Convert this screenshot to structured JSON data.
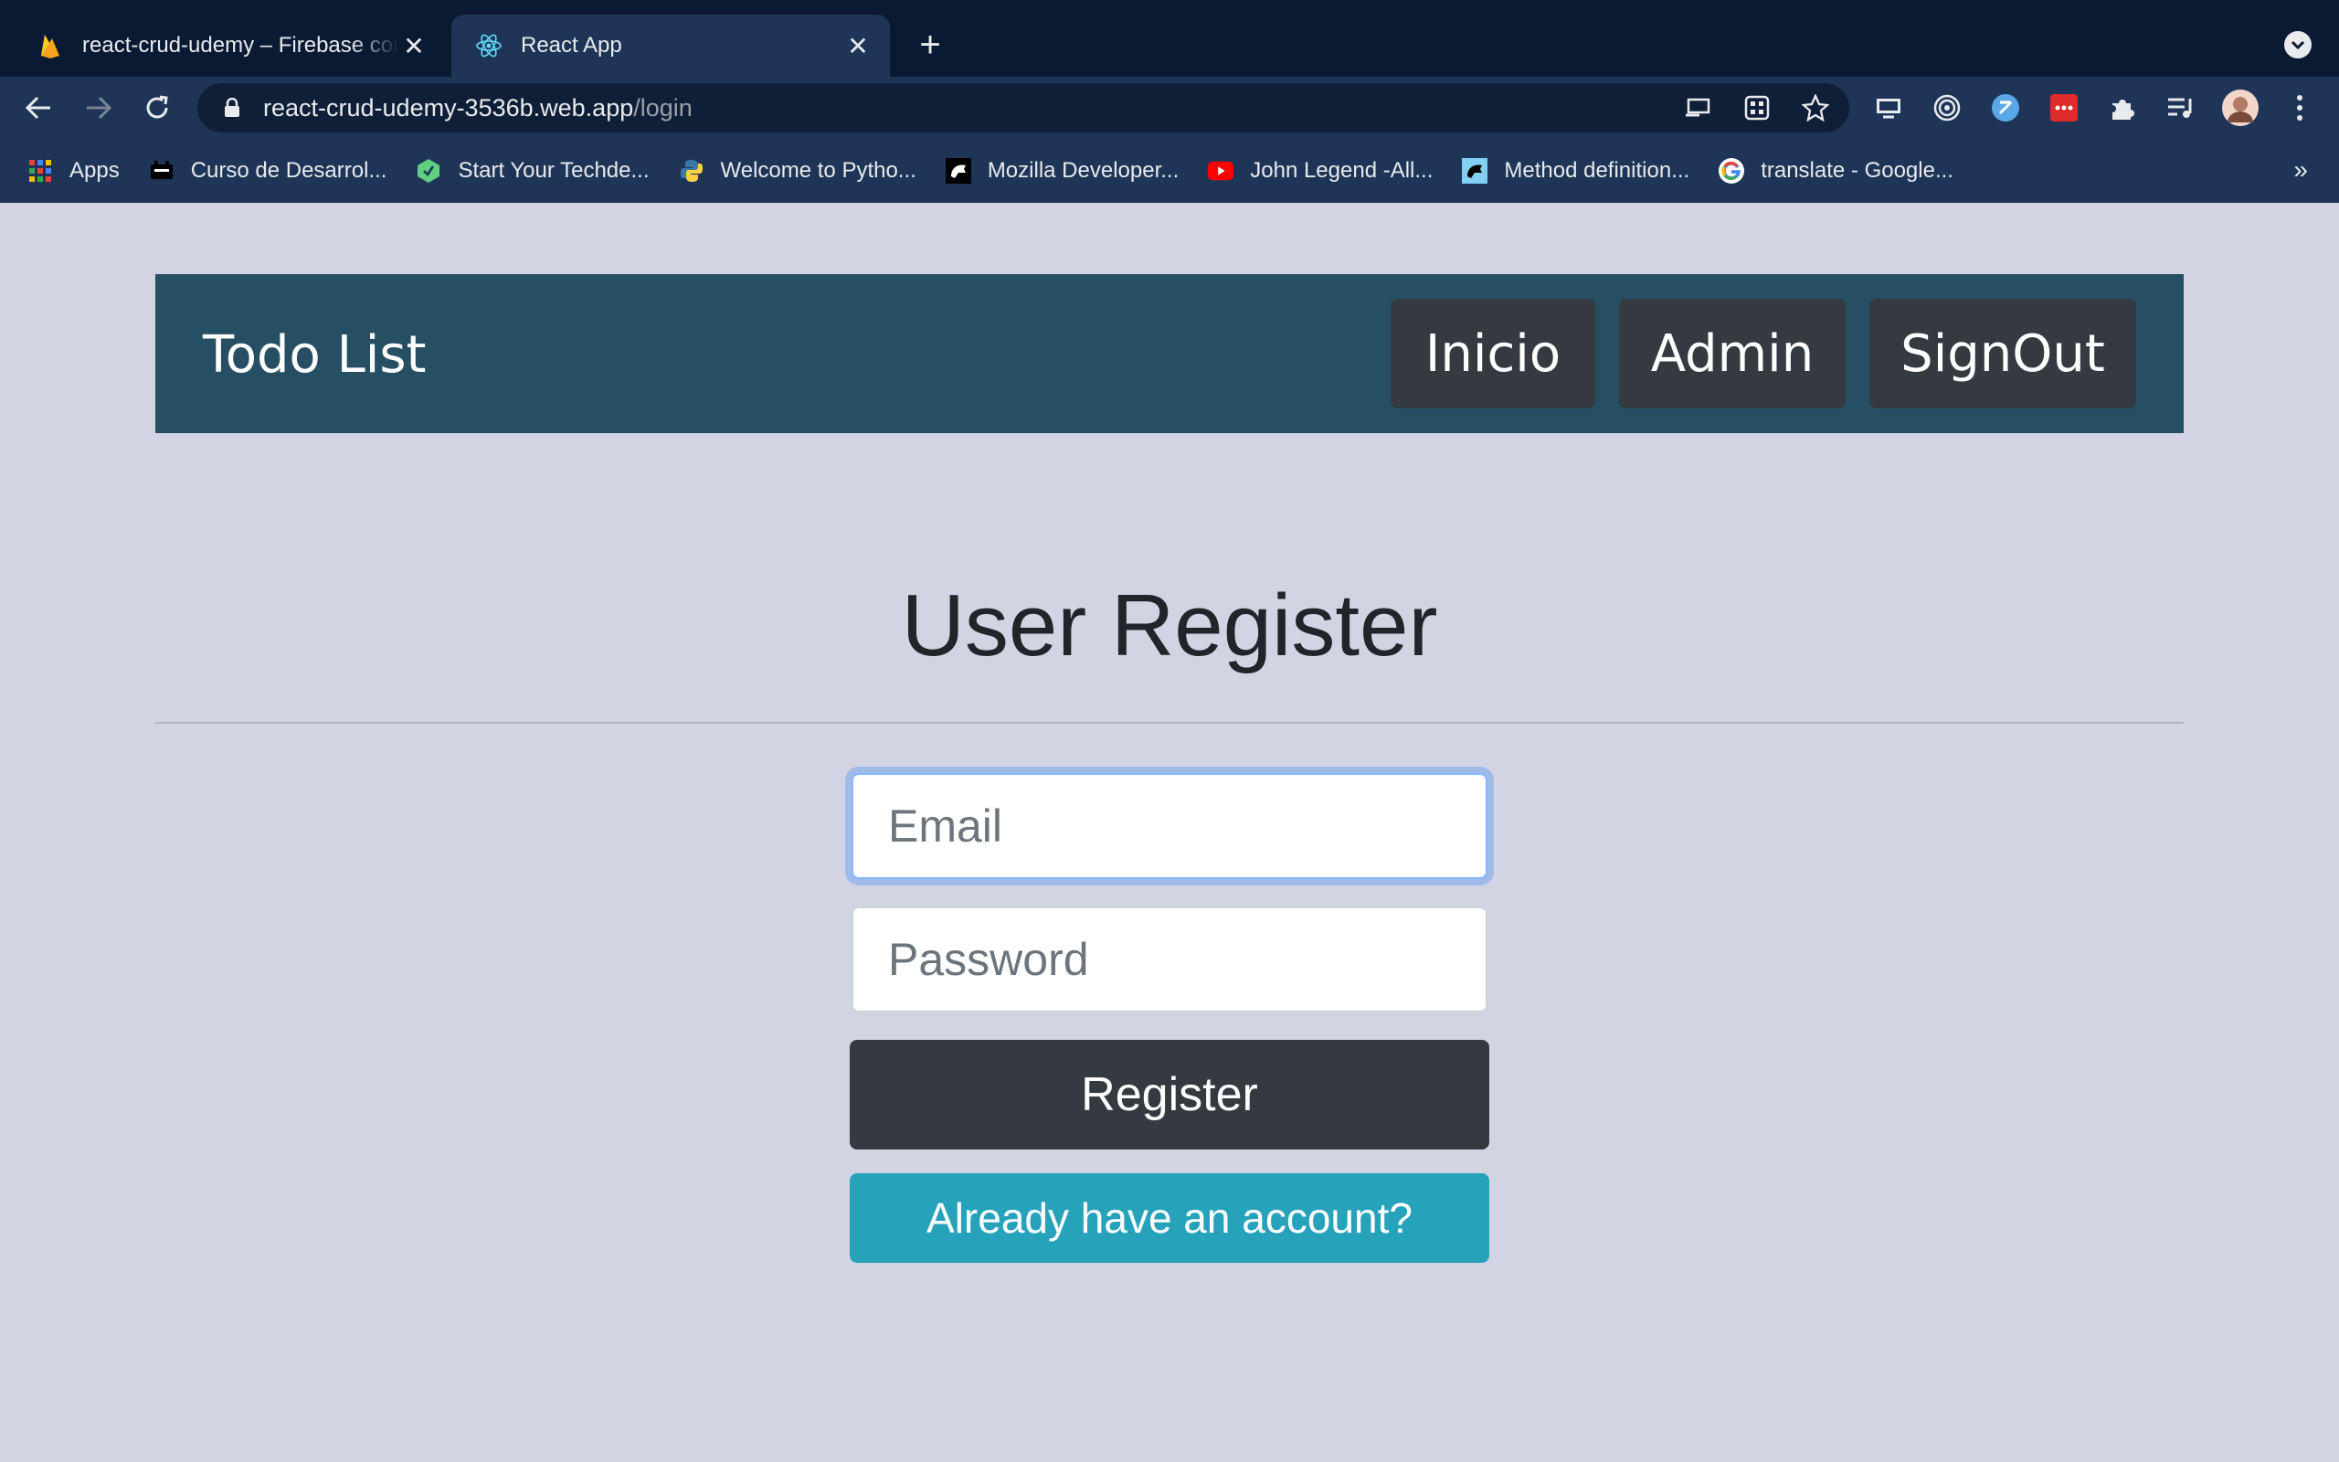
{
  "browser": {
    "tabs": [
      {
        "title": "react-crud-udemy – Firebase console",
        "icon": "firebase-icon",
        "active": false
      },
      {
        "title": "React App",
        "icon": "react-icon",
        "active": true
      }
    ],
    "url_domain": "react-crud-udemy-3536b.web.app",
    "url_path": "/login",
    "bookmarks": [
      {
        "label": "Apps",
        "icon": "apps-grid-icon"
      },
      {
        "label": "Curso de Desarrol...",
        "icon": "course-icon"
      },
      {
        "label": "Start Your Techde...",
        "icon": "techdegree-icon"
      },
      {
        "label": "Welcome to Pytho...",
        "icon": "python-icon"
      },
      {
        "label": "Mozilla Developer...",
        "icon": "mdn-icon"
      },
      {
        "label": "John Legend -All...",
        "icon": "youtube-icon"
      },
      {
        "label": "Method definition...",
        "icon": "mdn-icon"
      },
      {
        "label": "translate - Google...",
        "icon": "google-icon"
      }
    ],
    "bookmarks_more": "»"
  },
  "navbar": {
    "brand": "Todo List",
    "links": [
      "Inicio",
      "Admin",
      "SignOut"
    ]
  },
  "form": {
    "title": "User Register",
    "email_placeholder": "Email",
    "password_placeholder": "Password",
    "submit_label": "Register",
    "switch_label": "Already have an account?"
  },
  "colors": {
    "page_background": "#d3d4e3",
    "navbar": "#274f63",
    "dark_button": "#343a40",
    "info_button": "#26a3bb"
  }
}
